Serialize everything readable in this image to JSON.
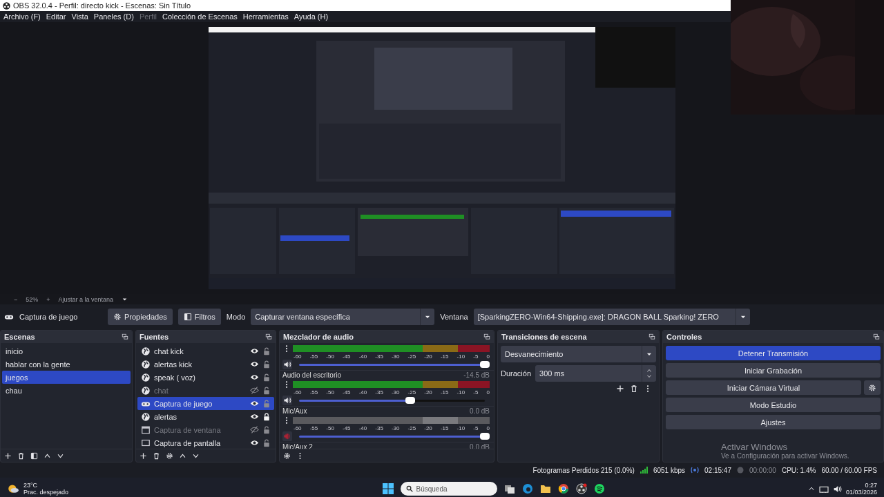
{
  "window": {
    "title": "OBS 32.0.4 - Perfil: directo kick - Escenas: Sin Título"
  },
  "menu": [
    {
      "label": "Archivo (F)",
      "disabled": false
    },
    {
      "label": "Editar",
      "disabled": false
    },
    {
      "label": "Vista",
      "disabled": false
    },
    {
      "label": "Paneles (D)",
      "disabled": false
    },
    {
      "label": "Perfil",
      "disabled": true
    },
    {
      "label": "Colección de Escenas",
      "disabled": false
    },
    {
      "label": "Herramientas",
      "disabled": false
    },
    {
      "label": "Ayuda (H)",
      "disabled": false
    }
  ],
  "zoom_bar": {
    "minus": "−",
    "zoom": "52%",
    "plus": "+",
    "fit": "Ajustar a la ventana"
  },
  "source_bar": {
    "source": "Captura de juego",
    "properties": "Propiedades",
    "filters": "Filtros",
    "mode_label": "Modo",
    "mode": "Capturar ventana específica",
    "window_label": "Ventana",
    "window": "[SparkingZERO-Win64-Shipping.exe]: DRAGON BALL Sparking! ZERO"
  },
  "scenes": {
    "title": "Escenas",
    "items": [
      {
        "label": "inicio",
        "selected": false
      },
      {
        "label": "hablar con la gente",
        "selected": false
      },
      {
        "label": "juegos",
        "selected": true
      },
      {
        "label": "chau",
        "selected": false
      }
    ]
  },
  "sources": {
    "title": "Fuentes",
    "items": [
      {
        "label": "chat kick",
        "kind": "browser",
        "visible": true,
        "locked": false,
        "selected": false
      },
      {
        "label": "alertas kick",
        "kind": "browser",
        "visible": true,
        "locked": false,
        "selected": false
      },
      {
        "label": "speak ( voz)",
        "kind": "browser",
        "visible": true,
        "locked": false,
        "selected": false
      },
      {
        "label": "chat",
        "kind": "browser",
        "visible": false,
        "locked": false,
        "selected": false
      },
      {
        "label": "Captura de juego",
        "kind": "game",
        "visible": true,
        "locked": false,
        "selected": true
      },
      {
        "label": "alertas",
        "kind": "browser",
        "visible": true,
        "locked": true,
        "selected": false
      },
      {
        "label": "Captura de ventana",
        "kind": "window",
        "visible": false,
        "locked": false,
        "selected": false
      },
      {
        "label": "Captura de pantalla",
        "kind": "display",
        "visible": true,
        "locked": false,
        "selected": false
      }
    ]
  },
  "mixer": {
    "title": "Mezclador de audio",
    "channels": [
      {
        "muted": false,
        "level": 1.0,
        "scale": [
          "-60",
          "-55",
          "-50",
          "-45",
          "-40",
          "-35",
          "-30",
          "-25",
          "-20",
          "-15",
          "-10",
          "-5",
          "0"
        ]
      },
      {
        "name": "Audio del escritorio",
        "reading": "-14.5 dB",
        "muted": false,
        "level": 0.6,
        "scale": [
          "-60",
          "-55",
          "-50",
          "-45",
          "-40",
          "-35",
          "-30",
          "-25",
          "-20",
          "-15",
          "-10",
          "-5",
          "0"
        ]
      },
      {
        "name": "Mic/Aux",
        "reading": "0.0 dB",
        "muted": true,
        "level": 1.0,
        "scale": [
          "-60",
          "-55",
          "-50",
          "-45",
          "-40",
          "-35",
          "-30",
          "-25",
          "-20",
          "-15",
          "-10",
          "-5",
          "0"
        ]
      },
      {
        "name": "Mic/Aux 2",
        "reading": "0.0 dB"
      }
    ]
  },
  "transitions": {
    "title": "Transiciones de escena",
    "type": "Desvanecimiento",
    "duration_label": "Duración",
    "duration": "300 ms"
  },
  "controls": {
    "title": "Controles",
    "buttons": [
      {
        "label": "Detener Transmisión",
        "active": true,
        "settings": false
      },
      {
        "label": "Iniciar Grabación",
        "active": false,
        "settings": false
      },
      {
        "label": "Iniciar Cámara Virtual",
        "active": false,
        "settings": true
      },
      {
        "label": "Modo Estudio",
        "active": false,
        "settings": false
      },
      {
        "label": "Ajustes",
        "active": false,
        "settings": false
      }
    ]
  },
  "activation": {
    "title": "Activar Windows",
    "text": "Ve a Configuración para activar Windows."
  },
  "status_bar": {
    "dropped": "Fotogramas Perdidos 215 (0.0%)",
    "bitrate": "6051 kbps",
    "stream_time": "02:15:47",
    "rec_time": "00:00:00",
    "cpu": "CPU: 1.4%",
    "fps": "60.00 / 60.00 FPS"
  },
  "taskbar": {
    "temp": "23°C",
    "weather": "Prac. despejado",
    "search": "Búsqueda",
    "time": "0:27",
    "date": "01/03/2026"
  }
}
